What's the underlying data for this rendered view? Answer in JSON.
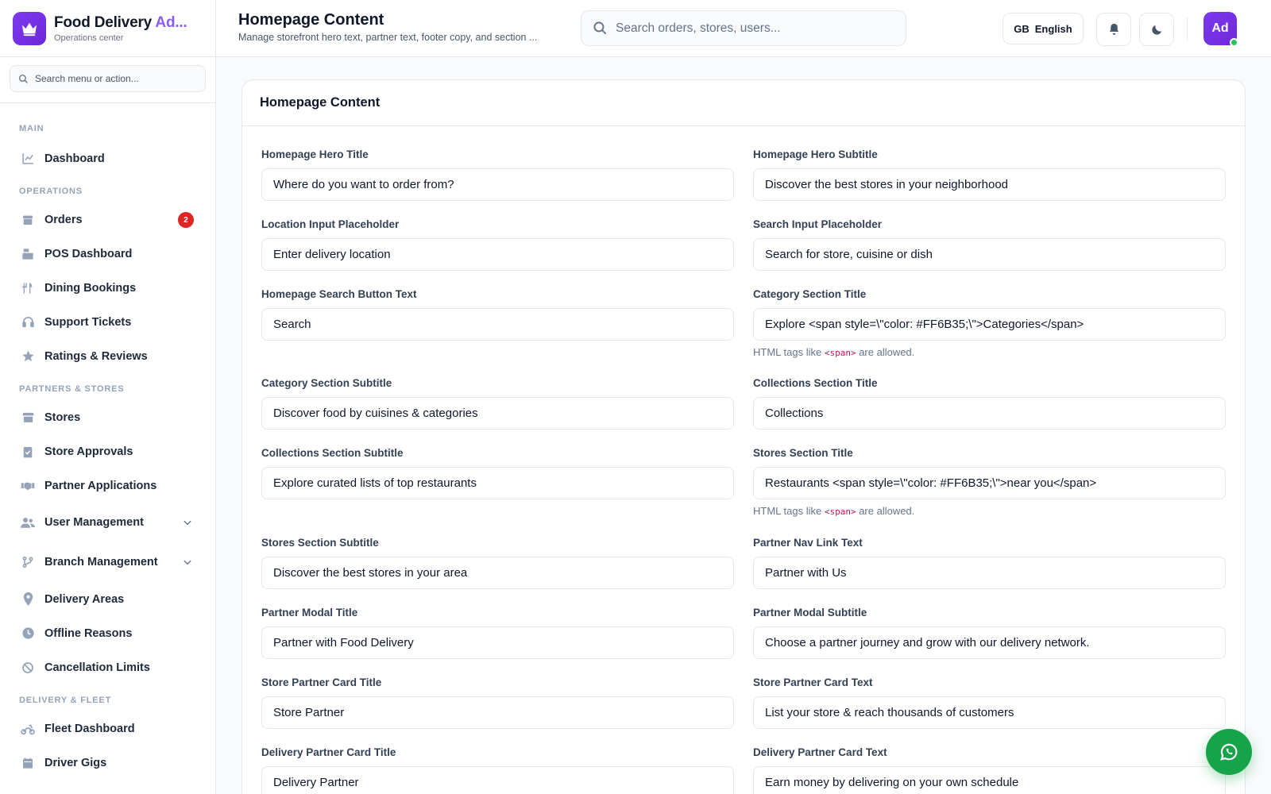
{
  "brand": {
    "title_main": "Food Delivery ",
    "title_accent": "Ad...",
    "subtitle": "Operations center"
  },
  "sidebar": {
    "search_placeholder": "Search menu or action...",
    "sections": {
      "main": "MAIN",
      "operations": "OPERATIONS",
      "partners": "PARTNERS & STORES",
      "delivery": "DELIVERY & FLEET"
    },
    "items": {
      "dashboard": "Dashboard",
      "orders": "Orders",
      "orders_badge": "2",
      "pos": "POS Dashboard",
      "dining": "Dining Bookings",
      "support": "Support Tickets",
      "ratings": "Ratings & Reviews",
      "stores": "Stores",
      "approvals": "Store Approvals",
      "partner_apps": "Partner Applications",
      "user_mgmt": "User Management",
      "branch_mgmt": "Branch Management",
      "delivery_areas": "Delivery Areas",
      "offline": "Offline Reasons",
      "cancellation": "Cancellation Limits",
      "fleet": "Fleet Dashboard",
      "gigs": "Driver Gigs"
    }
  },
  "header": {
    "title": "Homepage Content",
    "subtitle": "Manage storefront hero text, partner text, footer copy, and section ...",
    "search_placeholder": "Search orders, stores, users...",
    "lang_code": "GB",
    "lang_label": "English",
    "avatar": "Ad"
  },
  "card": {
    "title": "Homepage Content",
    "hint_prefix": "HTML tags like ",
    "hint_code": "<span>",
    "hint_suffix": " are allowed.",
    "fields": {
      "hero_title": {
        "label": "Homepage Hero Title",
        "value": "Where do you want to order from?"
      },
      "hero_subtitle": {
        "label": "Homepage Hero Subtitle",
        "value": "Discover the best stores in your neighborhood"
      },
      "location_placeholder": {
        "label": "Location Input Placeholder",
        "value": "Enter delivery location"
      },
      "search_placeholder": {
        "label": "Search Input Placeholder",
        "value": "Search for store, cuisine or dish"
      },
      "search_button": {
        "label": "Homepage Search Button Text",
        "value": "Search"
      },
      "category_title": {
        "label": "Category Section Title",
        "value": "Explore <span style=\\\"color: #FF6B35;\\\">Categories</span>"
      },
      "category_subtitle": {
        "label": "Category Section Subtitle",
        "value": "Discover food by cuisines & categories"
      },
      "collections_title": {
        "label": "Collections Section Title",
        "value": "Collections"
      },
      "collections_subtitle": {
        "label": "Collections Section Subtitle",
        "value": "Explore curated lists of top restaurants"
      },
      "stores_title": {
        "label": "Stores Section Title",
        "value": "Restaurants <span style=\\\"color: #FF6B35;\\\">near you</span>"
      },
      "stores_subtitle": {
        "label": "Stores Section Subtitle",
        "value": "Discover the best stores in your area"
      },
      "partner_nav": {
        "label": "Partner Nav Link Text",
        "value": "Partner with Us"
      },
      "partner_modal_title": {
        "label": "Partner Modal Title",
        "value": "Partner with Food Delivery"
      },
      "partner_modal_subtitle": {
        "label": "Partner Modal Subtitle",
        "value": "Choose a partner journey and grow with our delivery network."
      },
      "store_card_title": {
        "label": "Store Partner Card Title",
        "value": "Store Partner"
      },
      "store_card_text": {
        "label": "Store Partner Card Text",
        "value": "List your store & reach thousands of customers"
      },
      "delivery_card_title": {
        "label": "Delivery Partner Card Title",
        "value": "Delivery Partner"
      },
      "delivery_card_text": {
        "label": "Delivery Partner Card Text",
        "value": "Earn money by delivering on your own schedule"
      }
    }
  },
  "colors": {
    "accent": "#7c3aed",
    "badge": "#dc2626",
    "whatsapp": "#16a34a",
    "online": "#22c55e"
  }
}
